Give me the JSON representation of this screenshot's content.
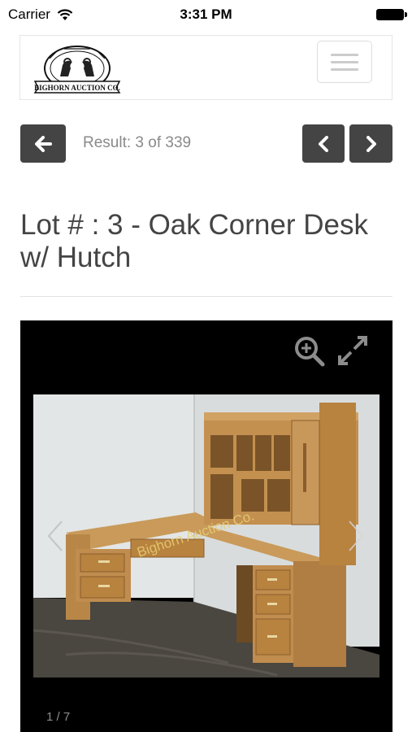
{
  "status_bar": {
    "carrier": "Carrier",
    "time": "3:31 PM"
  },
  "header": {
    "logo_arc_text": "DOUBT · FARM · RANCH · HOUSEHOLD · LIQUIDATION",
    "logo_name": "BIGHORN AUCTION CO.",
    "menu_icon": "hamburger-icon"
  },
  "navigation": {
    "back_icon": "arrow-left-icon",
    "result_text": "Result: 3 of 339",
    "prev_icon": "chevron-left-icon",
    "next_icon": "chevron-right-icon"
  },
  "lot": {
    "title": "Lot # : 3 - Oak Corner Desk w/ Hutch"
  },
  "gallery": {
    "watermark": "Bighorn Auction Co.",
    "counter": "1 / 7",
    "zoom_icon": "zoom-in-icon",
    "expand_icon": "expand-icon"
  },
  "colors": {
    "button_dark": "#444444",
    "title_text": "#444444",
    "muted_text": "#8a8a8a",
    "gallery_bg": "#000000"
  }
}
